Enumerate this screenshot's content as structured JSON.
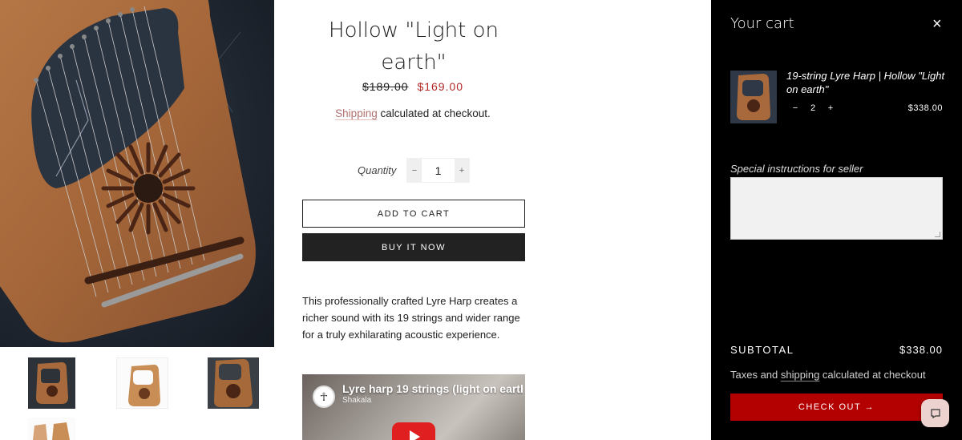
{
  "product": {
    "title_line1": "Hollow \"Light on",
    "title_line2": "earth\"",
    "price_original": "$189.00",
    "price_sale": "$169.00",
    "shipping_link": "Shipping",
    "shipping_text": " calculated at checkout.",
    "quantity_label": "Quantity",
    "quantity_minus": "−",
    "quantity_value": "1",
    "quantity_plus": "+",
    "add_to_cart": "ADD TO CART",
    "buy_now": "BUY IT NOW",
    "description": "This professionally crafted Lyre Harp creates a richer sound with its 19 strings and wider range for a truly exhilarating acoustic experience.",
    "video_title": "Lyre harp 19 strings (light on earth",
    "video_channel": "Shakala"
  },
  "cart": {
    "title": "Your cart",
    "close": "×",
    "item": {
      "title": "19-string Lyre Harp | Hollow \"Light on earth\"",
      "qty_minus": "−",
      "qty_value": "2",
      "qty_plus": "+",
      "price": "$338.00"
    },
    "notes_label": "Special instructions for seller",
    "subtotal_label": "SUBTOTAL",
    "subtotal_value": "$338.00",
    "taxes_prefix": "Taxes and ",
    "taxes_link": "shipping",
    "taxes_suffix": " calculated at checkout",
    "checkout": "CHECK OUT →"
  },
  "colors": {
    "sale_price": "#b22828",
    "checkout_button": "#b30000",
    "drawer_bg": "#000000",
    "buy_button": "#222222"
  },
  "icons": {
    "close": "close-icon",
    "chat": "chat-icon",
    "play": "play-icon"
  }
}
